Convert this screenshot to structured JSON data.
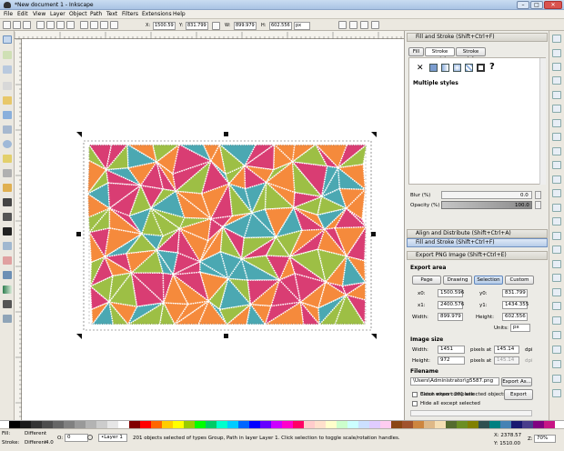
{
  "window": {
    "title": "*New document 1 - Inkscape",
    "buttons": [
      "–",
      "□",
      "✕"
    ]
  },
  "menu": [
    "File",
    "Edit",
    "View",
    "Layer",
    "Object",
    "Path",
    "Text",
    "Filters",
    "Extensions",
    "Help"
  ],
  "toolbar": {
    "x_label": "X:",
    "x": "1500.59",
    "y_label": "Y:",
    "y": "831.799",
    "w_label": "W:",
    "w": "899.979",
    "h_label": "H:",
    "h": "602.556",
    "unit": "px"
  },
  "fill_stroke": {
    "header": "Fill and Stroke (Shift+Ctrl+F)",
    "tabs": [
      "Fill",
      "Stroke paint",
      "Stroke style"
    ],
    "x_symbol": "✕",
    "question": "?",
    "state": "Multiple styles",
    "blur_label": "Blur (%)",
    "blur": "0.0",
    "opacity_label": "Opacity (%)",
    "opacity": "100.0"
  },
  "docked": {
    "align": "Align and Distribute (Shift+Ctrl+A)",
    "fill": "Fill and Stroke (Shift+Ctrl+F)"
  },
  "export": {
    "header": "Export PNG Image (Shift+Ctrl+E)",
    "area_title": "Export area",
    "area_buttons": [
      "Page",
      "Drawing",
      "Selection",
      "Custom"
    ],
    "x0_label": "x0:",
    "x0": "1500.596",
    "y0_label": "y0:",
    "y0": "831.799",
    "x1_label": "x1:",
    "x1": "2400.576",
    "y1_label": "y1:",
    "y1": "1434.355",
    "width_label": "Width:",
    "width": "899.979",
    "height_label": "Height:",
    "height": "602.556",
    "units_label": "Units:",
    "units": "px",
    "size_title": "Image size",
    "iw_label": "Width:",
    "iw": "1451",
    "pixels_at": "pixels at",
    "dpi1": "145.14",
    "dpi_label": "dpi",
    "ih_label": "Height:",
    "ih": "972",
    "dpi2": "145.14",
    "filename_title": "Filename",
    "filename": "\\Users\\Administrator\\g5587.png",
    "export_as": "Export As...",
    "batch": "Batch export 201 selected objects",
    "hide": "Hide all except selected",
    "close_complete": "Close when complete",
    "export_btn": "Export"
  },
  "status": {
    "fill_label": "Fill:",
    "fill_value": "Different",
    "stroke_label": "Stroke:",
    "stroke_value": "Different",
    "stroke_width": "4.0",
    "o_label": "O:",
    "opacity": "0",
    "layer": "•Layer 1",
    "message": "201 objects selected of types Group, Path in layer Layer 1. Click selection to toggle scale/rotation handles.",
    "x_coord": "X: 2378.57",
    "y_coord": "Y: 1510.00",
    "z_label": "Z:",
    "zoom": "70%"
  },
  "colors": {
    "pink": "#d93d73",
    "orange": "#f58a3c",
    "green": "#9dbf45",
    "teal": "#4ba8b2",
    "select": "#4e8fd8"
  }
}
